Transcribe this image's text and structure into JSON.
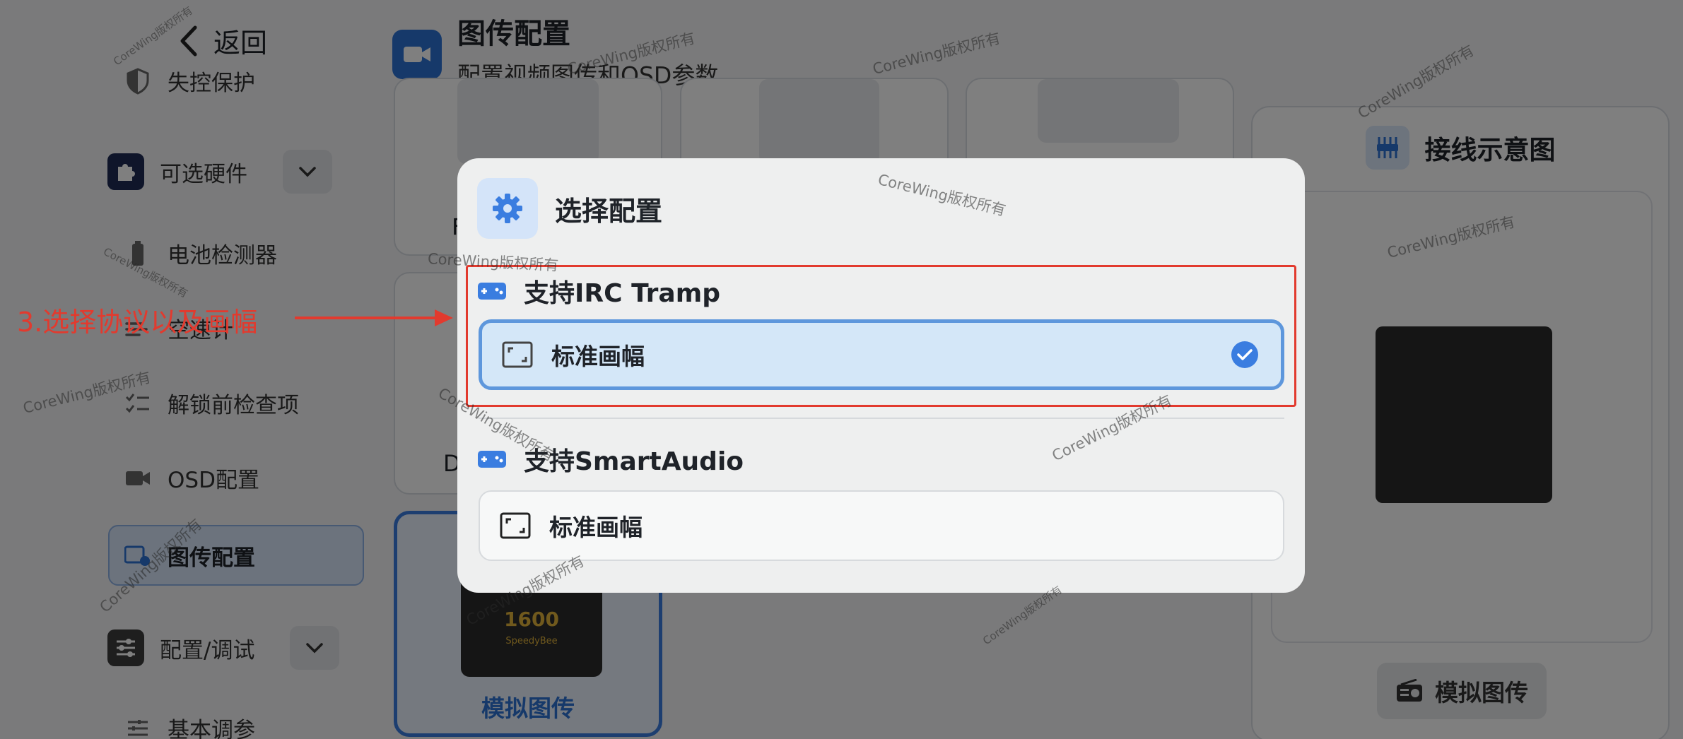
{
  "sidebar": {
    "back_label": "返回",
    "items": {
      "failsafe": "失控保护",
      "optional_hw": "可选硬件",
      "battery": "电池检测器",
      "airspeed": "空速计",
      "prearm": "解锁前检查项",
      "osd": "OSD配置",
      "vtx": "图传配置",
      "config_tune": "配置/调试",
      "basic_tune": "基本调参"
    }
  },
  "header": {
    "title": "图传配置",
    "subtitle": "配置视频图传和OSD参数"
  },
  "cards": {
    "left_partial_1": "F",
    "left_partial_2": "D",
    "selected_label": "模拟图传",
    "thumb_text": "1600",
    "thumb_brand": "SpeedyBee"
  },
  "wiring": {
    "title": "接线示意图",
    "button_label": "模拟图传"
  },
  "dialog": {
    "title": "选择配置",
    "sections": [
      {
        "title": "支持IRC Tramp",
        "option": "标准画幅",
        "selected": true
      },
      {
        "title": "支持SmartAudio",
        "option": "标准画幅",
        "selected": false
      }
    ]
  },
  "annotation": {
    "text": "3.选择协议以及画幅",
    "color": "#e23a2e"
  },
  "watermark": "CoreWing版权所有",
  "colors": {
    "accent": "#3a7de0",
    "annotation_red": "#e23a2e"
  }
}
